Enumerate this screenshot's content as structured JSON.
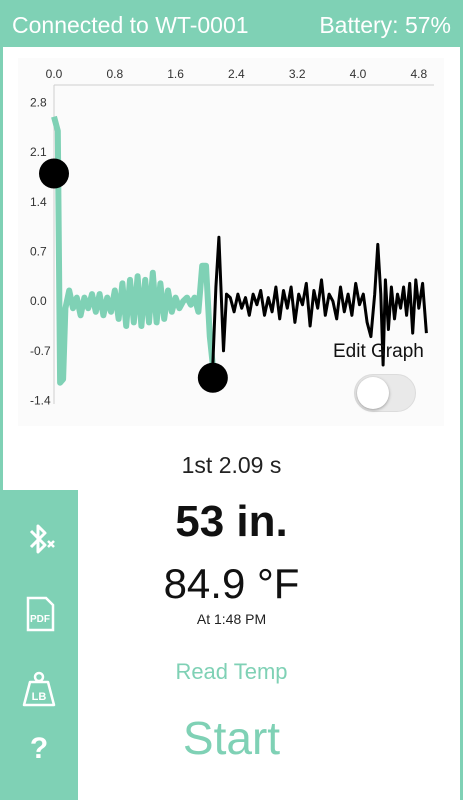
{
  "status_bar": {
    "connection": "Connected to WT-0001",
    "battery": "Battery: 57%"
  },
  "graph": {
    "edit_label": "Edit Graph",
    "edit_toggle_on": false
  },
  "chart_data": {
    "type": "line",
    "x_ticks": [
      "0.0",
      "0.8",
      "1.6",
      "2.4",
      "3.2",
      "4.0",
      "4.8"
    ],
    "y_ticks": [
      "2.8",
      "2.1",
      "1.4",
      "0.7",
      "0.0",
      "-0.7",
      "-1.4"
    ],
    "xlim": [
      0.0,
      5.0
    ],
    "ylim": [
      -1.45,
      2.85
    ],
    "series": [
      {
        "color": "#7fd1b5",
        "x": [
          0.0,
          0.05,
          0.08,
          0.12,
          0.15,
          0.2,
          0.25,
          0.3,
          0.35,
          0.4,
          0.45,
          0.5,
          0.55,
          0.6,
          0.65,
          0.7,
          0.75,
          0.8,
          0.85,
          0.9,
          0.95,
          1.0,
          1.05,
          1.1,
          1.15,
          1.2,
          1.25,
          1.3,
          1.35,
          1.4,
          1.45,
          1.5,
          1.55,
          1.6,
          1.65,
          1.7,
          1.75,
          1.8,
          1.85,
          1.9,
          1.95,
          2.0,
          2.05,
          2.09
        ],
        "y": [
          2.6,
          2.4,
          -1.15,
          -1.1,
          -0.1,
          0.15,
          -0.1,
          0.05,
          -0.2,
          0.05,
          -0.1,
          0.1,
          -0.15,
          0.1,
          -0.2,
          0.05,
          -0.15,
          0.15,
          -0.25,
          0.25,
          -0.35,
          0.3,
          -0.3,
          0.35,
          -0.35,
          0.3,
          -0.3,
          0.4,
          -0.3,
          0.25,
          -0.25,
          0.15,
          -0.15,
          0.05,
          -0.1,
          0.0,
          0.05,
          -0.05,
          0.05,
          -0.15,
          0.5,
          0.5,
          -0.5,
          -0.9
        ]
      },
      {
        "color": "#000000",
        "x": [
          2.09,
          2.13,
          2.17,
          2.2,
          2.23,
          2.27,
          2.32,
          2.37,
          2.42,
          2.47,
          2.52,
          2.57,
          2.62,
          2.67,
          2.72,
          2.77,
          2.82,
          2.87,
          2.92,
          2.97,
          3.02,
          3.07,
          3.12,
          3.17,
          3.22,
          3.27,
          3.32,
          3.37,
          3.42,
          3.47,
          3.52,
          3.57,
          3.62,
          3.67,
          3.72,
          3.77,
          3.82,
          3.87,
          3.92,
          3.97,
          4.02,
          4.07,
          4.12,
          4.17,
          4.22,
          4.26,
          4.3,
          4.33,
          4.36,
          4.4,
          4.44,
          4.48,
          4.52,
          4.56,
          4.6,
          4.64,
          4.68,
          4.72,
          4.76,
          4.8,
          4.85,
          4.9
        ],
        "y": [
          -0.9,
          0.2,
          0.9,
          0.1,
          -0.7,
          0.1,
          0.05,
          -0.15,
          0.1,
          -0.1,
          0.05,
          -0.2,
          0.1,
          -0.05,
          0.15,
          -0.2,
          0.05,
          -0.15,
          0.2,
          -0.25,
          0.15,
          -0.1,
          0.2,
          -0.3,
          0.1,
          -0.05,
          0.25,
          -0.35,
          0.15,
          -0.1,
          0.3,
          -0.2,
          0.1,
          0.0,
          -0.25,
          0.2,
          -0.15,
          0.1,
          -0.2,
          0.25,
          -0.05,
          0.1,
          -0.3,
          -0.5,
          0.1,
          0.8,
          0.1,
          -0.9,
          0.3,
          -0.4,
          0.2,
          -0.25,
          0.1,
          -0.1,
          0.2,
          -0.2,
          0.25,
          -0.45,
          0.3,
          -0.1,
          0.25,
          -0.45
        ]
      }
    ],
    "markers": [
      {
        "x": 0.0,
        "y": 1.8
      },
      {
        "x": 2.09,
        "y": -1.08
      }
    ]
  },
  "sidebar": {
    "icons": [
      "bluetooth-off-icon",
      "pdf-icon",
      "weight-lb-icon",
      "help-icon"
    ],
    "pdf_label": "PDF",
    "lb_label": "LB",
    "help_label": "?"
  },
  "readout": {
    "lap": "1st 2.09 s",
    "distance": "53 in.",
    "temperature": "84.9 °F",
    "time": "At 1:48 PM",
    "read_temp": "Read Temp",
    "start": "Start"
  },
  "colors": {
    "accent": "#7fd1b5",
    "signal": "#000000"
  }
}
